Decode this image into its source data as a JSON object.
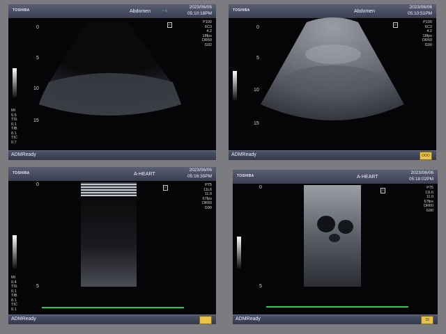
{
  "panels": [
    {
      "brand": "TOSHIBA",
      "mode": "Abdomen",
      "date": "2023/06/06",
      "time": "05:10:18PM",
      "params": [
        "P100",
        "6C3",
        "4.2",
        "18fps",
        "DR60",
        "G92"
      ],
      "depth_labels": [
        "0",
        "5",
        "10",
        "15"
      ],
      "left_labels": [
        "MI",
        "0.5",
        "TIS",
        "0.1",
        "TIB",
        "0.1",
        "TIC",
        "0.7"
      ],
      "status": "ADMReady"
    },
    {
      "brand": "TOSHIBA",
      "mode": "Abdomen",
      "date": "2023/06/06",
      "time": "05:10:51PM",
      "params": [
        "P100",
        "6C3",
        "4.2",
        "18fps",
        "DR60",
        "G90"
      ],
      "depth_labels": [
        "0",
        "5",
        "10",
        "15"
      ],
      "left_labels": [],
      "status": "ADMReady",
      "badge": "OOO"
    },
    {
      "brand": "TOSHIBA",
      "mode": "A-HEART",
      "date": "2023/06/06",
      "time": "05:16:35PM",
      "params": [
        "P75",
        "11L6",
        "11.0",
        "67fps",
        "DR60",
        "G90"
      ],
      "depth_labels": [
        "0",
        "5"
      ],
      "left_labels": [
        "MI",
        "0.4",
        "TIS",
        "0.1",
        "TIB",
        "0.1",
        "TIC",
        "0.1"
      ],
      "status": "ADMReady"
    },
    {
      "brand": "TOSHIBA",
      "mode": "A-HEART",
      "date": "2023/06/06",
      "time": "05:18:02PM",
      "params": [
        "P75",
        "11L6",
        "11.0",
        "67fps",
        "DR60",
        "G90"
      ],
      "depth_labels": [
        "0",
        "5"
      ],
      "left_labels": [],
      "status": "ADMReady",
      "badge": "33"
    }
  ],
  "colors": {
    "header": "#4a4f66",
    "ecg": "#1cd04a",
    "badge": "#e6c24a"
  }
}
